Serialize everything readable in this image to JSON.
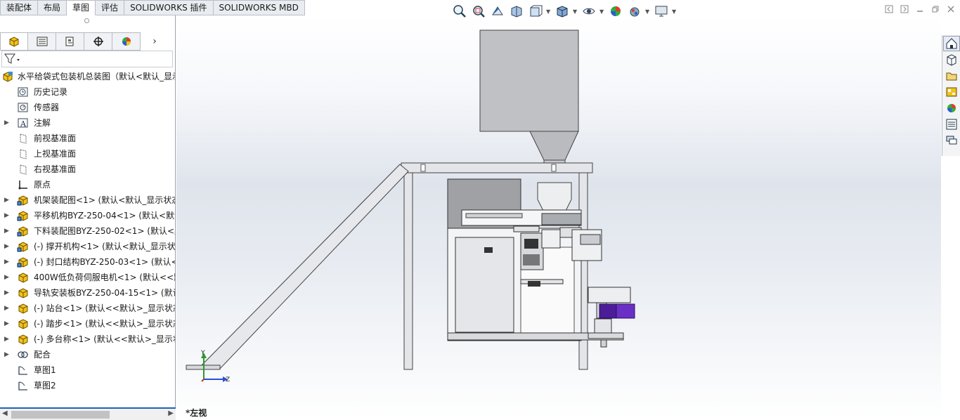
{
  "tabs": [
    "装配体",
    "布局",
    "草图",
    "评估",
    "SOLIDWORKS 插件",
    "SOLIDWORKS MBD"
  ],
  "active_tab": "草图",
  "panel": {
    "tab_icons": [
      "feature-manager-icon",
      "property-manager-icon",
      "configuration-manager-icon",
      "dimxpert-manager-icon",
      "display-manager-icon"
    ],
    "more_arrow": "›",
    "filter_icon": "filter-icon"
  },
  "tree": {
    "root": "水平给袋式包装机总装图（默认<默认_显示",
    "items": [
      {
        "label": "历史记录",
        "icon": "history-icon",
        "expandable": false
      },
      {
        "label": "传感器",
        "icon": "sensor-icon",
        "expandable": false
      },
      {
        "label": "注解",
        "icon": "annotation-icon",
        "expandable": true
      },
      {
        "label": "前视基准面",
        "icon": "plane-icon",
        "expandable": false
      },
      {
        "label": "上视基准面",
        "icon": "plane-icon",
        "expandable": false
      },
      {
        "label": "右视基准面",
        "icon": "plane-icon",
        "expandable": false
      },
      {
        "label": "原点",
        "icon": "origin-icon",
        "expandable": false
      },
      {
        "label": "机架装配图<1> (默认<默认_显示状态",
        "icon": "assembly-icon",
        "expandable": true
      },
      {
        "label": "平移机构BYZ-250-04<1> (默认<默认",
        "icon": "assembly-icon",
        "expandable": true
      },
      {
        "label": "下料装配图BYZ-250-02<1> (默认<默",
        "icon": "assembly-icon",
        "expandable": true
      },
      {
        "label": "(-) 撑开机构<1> (默认<默认_显示状态",
        "icon": "assembly-icon",
        "expandable": true
      },
      {
        "label": "(-) 封口结构BYZ-250-03<1> (默认<默",
        "icon": "assembly-icon",
        "expandable": true
      },
      {
        "label": "400W低负荷伺服电机<1> (默认<<默",
        "icon": "part-icon",
        "expandable": true
      },
      {
        "label": "导轨安装板BYZ-250-04-15<1> (默认",
        "icon": "part-icon",
        "expandable": true
      },
      {
        "label": "(-) 站台<1> (默认<<默认>_显示状态",
        "icon": "part-icon",
        "expandable": true
      },
      {
        "label": "(-) 踏步<1> (默认<<默认>_显示状态",
        "icon": "part-icon",
        "expandable": true
      },
      {
        "label": "(-) 多台称<1> (默认<<默认>_显示状",
        "icon": "part-icon",
        "expandable": true
      },
      {
        "label": "配合",
        "icon": "mates-icon",
        "expandable": true
      },
      {
        "label": "草图1",
        "icon": "sketch-icon",
        "expandable": false
      },
      {
        "label": "草图2",
        "icon": "sketch-icon",
        "expandable": false
      }
    ]
  },
  "viewport": {
    "view_label": "*左视",
    "triad": {
      "y_label": "Y",
      "z_label": "Z"
    }
  },
  "hud_icons": [
    "zoom-to-fit-icon",
    "zoom-to-area-icon",
    "previous-view-icon",
    "section-view-icon",
    "view-orientation-icon",
    "display-style-icon",
    "hide-show-items-icon",
    "edit-appearance-icon",
    "apply-scene-icon",
    "view-settings-icon"
  ],
  "taskpane_icons": [
    "solidworks-resources-icon",
    "design-library-icon",
    "file-explorer-icon",
    "view-palette-icon",
    "appearances-icon",
    "custom-properties-icon",
    "forum-icon"
  ],
  "colors": {
    "accent": "#1e64b8",
    "motor": "#6a2fc4",
    "steel": "#d2d4d8",
    "frame": "#cfd2d6"
  }
}
